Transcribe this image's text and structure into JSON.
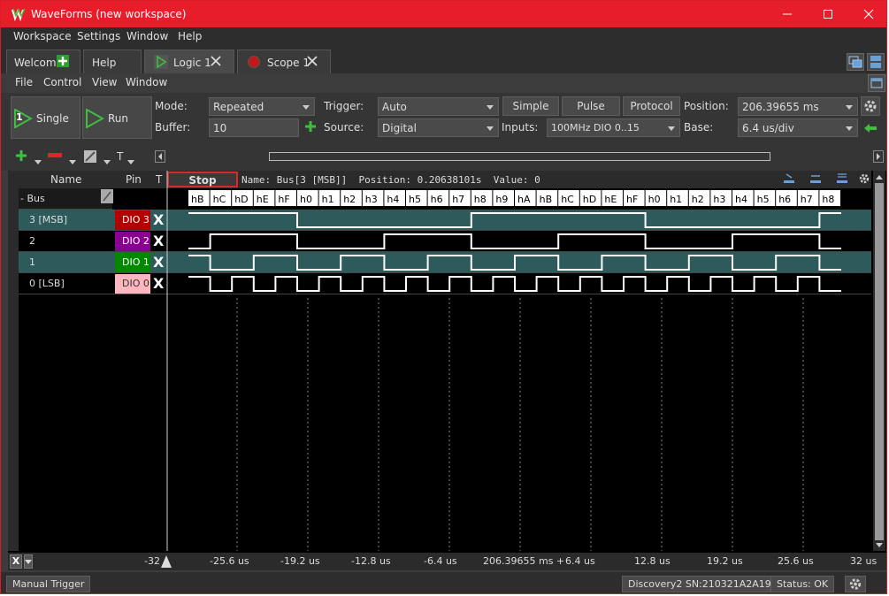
{
  "window": {
    "title": "WaveForms (new workspace)"
  },
  "menubar": {
    "items": [
      "Workspace",
      "Settings",
      "Window",
      "Help"
    ]
  },
  "tabs": {
    "welcome": "Welcome",
    "help": "Help",
    "logic": "Logic 1",
    "scope": "Scope 1"
  },
  "submenu": {
    "items": [
      "File",
      "Control",
      "View",
      "Window"
    ]
  },
  "toolbar": {
    "single": "Single",
    "single_badge": "1",
    "run": "Run",
    "mode_label": "Mode:",
    "mode_value": "Repeated",
    "buffer_label": "Buffer:",
    "buffer_value": "10",
    "trigger_label": "Trigger:",
    "trigger_value": "Auto",
    "source_label": "Source:",
    "source_value": "Digital",
    "simple": "Simple",
    "pulse": "Pulse",
    "protocol": "Protocol",
    "inputs_label": "Inputs:",
    "inputs_value": "100MHz DIO 0..15",
    "position_label": "Position:",
    "position_value": "206.39655 ms",
    "base_label": "Base:",
    "base_value": "6.4 us/div"
  },
  "toolbar2": {
    "t_label": "T"
  },
  "grid": {
    "headers": {
      "name": "Name",
      "pin": "Pin",
      "t": "T"
    },
    "stop": "Stop",
    "info": "Name: Bus[3 [MSB]]  Position: 0.20638101s  Value: 0",
    "bus": {
      "name": "- Bus",
      "values": [
        "hB",
        "hC",
        "hD",
        "hE",
        "hF",
        "h0",
        "h1",
        "h2",
        "h3",
        "h4",
        "h5",
        "h6",
        "h7",
        "h8",
        "h9",
        "hA",
        "hB",
        "hC",
        "hD",
        "hE",
        "hF",
        "h0",
        "h1",
        "h2",
        "h3",
        "h4",
        "h5",
        "h6",
        "h7",
        "h8"
      ]
    },
    "rows": [
      {
        "name": "3 [MSB]",
        "pin": "DIO 3",
        "pin_color": "#b40000",
        "pin_text": "#ffffff",
        "trig": "X"
      },
      {
        "name": "2",
        "pin": "DIO 2",
        "pin_color": "#8a0090",
        "pin_text": "#ffffff",
        "trig": "X"
      },
      {
        "name": "1",
        "pin": "DIO 1",
        "pin_color": "#008800",
        "pin_text": "#ffffff",
        "trig": "X"
      },
      {
        "name": "0 [LSB]",
        "pin": "DIO 0",
        "pin_color": "#ffb6c1",
        "pin_text": "#333333",
        "trig": "X"
      }
    ]
  },
  "axis": {
    "ticks": [
      "-32",
      "-25.6 us",
      "-19.2 us",
      "-12.8 us",
      "-6.4 us",
      "206.39655 ms +",
      "6.4 us",
      "12.8 us",
      "19.2 us",
      "25.6 us",
      "32 us"
    ],
    "x_button": "X"
  },
  "status": {
    "manual_trigger": "Manual Trigger",
    "device": "Discovery2 SN:210321A2A19B",
    "status": "Status: OK"
  },
  "colors": {
    "title_bar": "#e81d2a",
    "signal": "#ffffff",
    "row_fill": "#2d5a5a"
  }
}
